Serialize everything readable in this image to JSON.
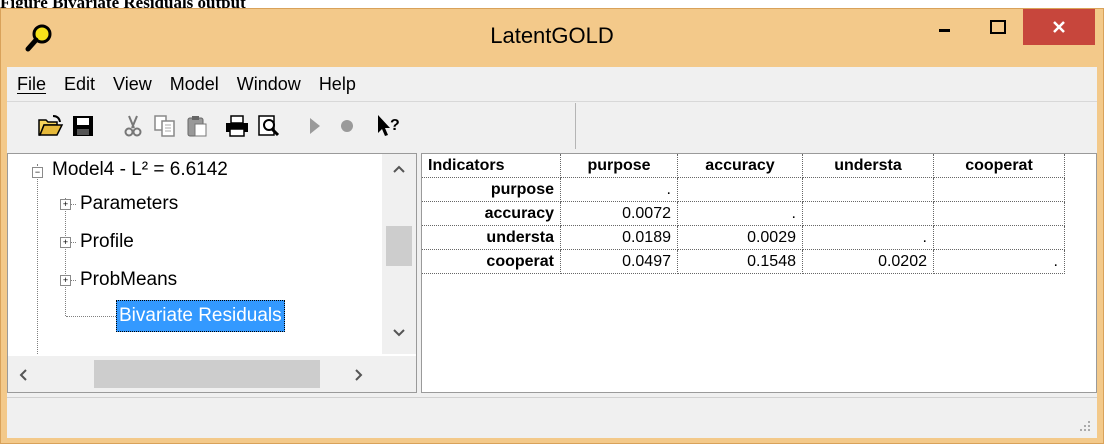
{
  "caption": "Figure  Bivariate Residuals output",
  "window": {
    "title": "LatentGOLD"
  },
  "menu": [
    "File",
    "Edit",
    "View",
    "Model",
    "Window",
    "Help"
  ],
  "toolbar": [
    "open-icon",
    "save-icon",
    "cut-icon",
    "copy-icon",
    "paste-icon",
    "print-icon",
    "print-preview-icon",
    "run-icon",
    "stop-icon",
    "context-help-icon"
  ],
  "tree": {
    "root": "Model4 - L² = 6.6142",
    "items": [
      "Parameters",
      "Profile",
      "ProbMeans"
    ],
    "selected": "Bivariate Residuals"
  },
  "table": {
    "headers": [
      "Indicators",
      "purpose",
      "accuracy",
      "understa",
      "cooperat"
    ],
    "rows": [
      {
        "label": "purpose",
        "cells": [
          ".",
          "",
          "",
          ""
        ]
      },
      {
        "label": "accuracy",
        "cells": [
          "0.0072",
          ".",
          "",
          ""
        ]
      },
      {
        "label": "understa",
        "cells": [
          "0.0189",
          "0.0029",
          ".",
          ""
        ]
      },
      {
        "label": "cooperat",
        "cells": [
          "0.0497",
          "0.1548",
          "0.0202",
          "."
        ]
      }
    ]
  },
  "colors": {
    "frame": "#f3c98a",
    "close": "#c7463c",
    "selection": "#3399ff"
  }
}
